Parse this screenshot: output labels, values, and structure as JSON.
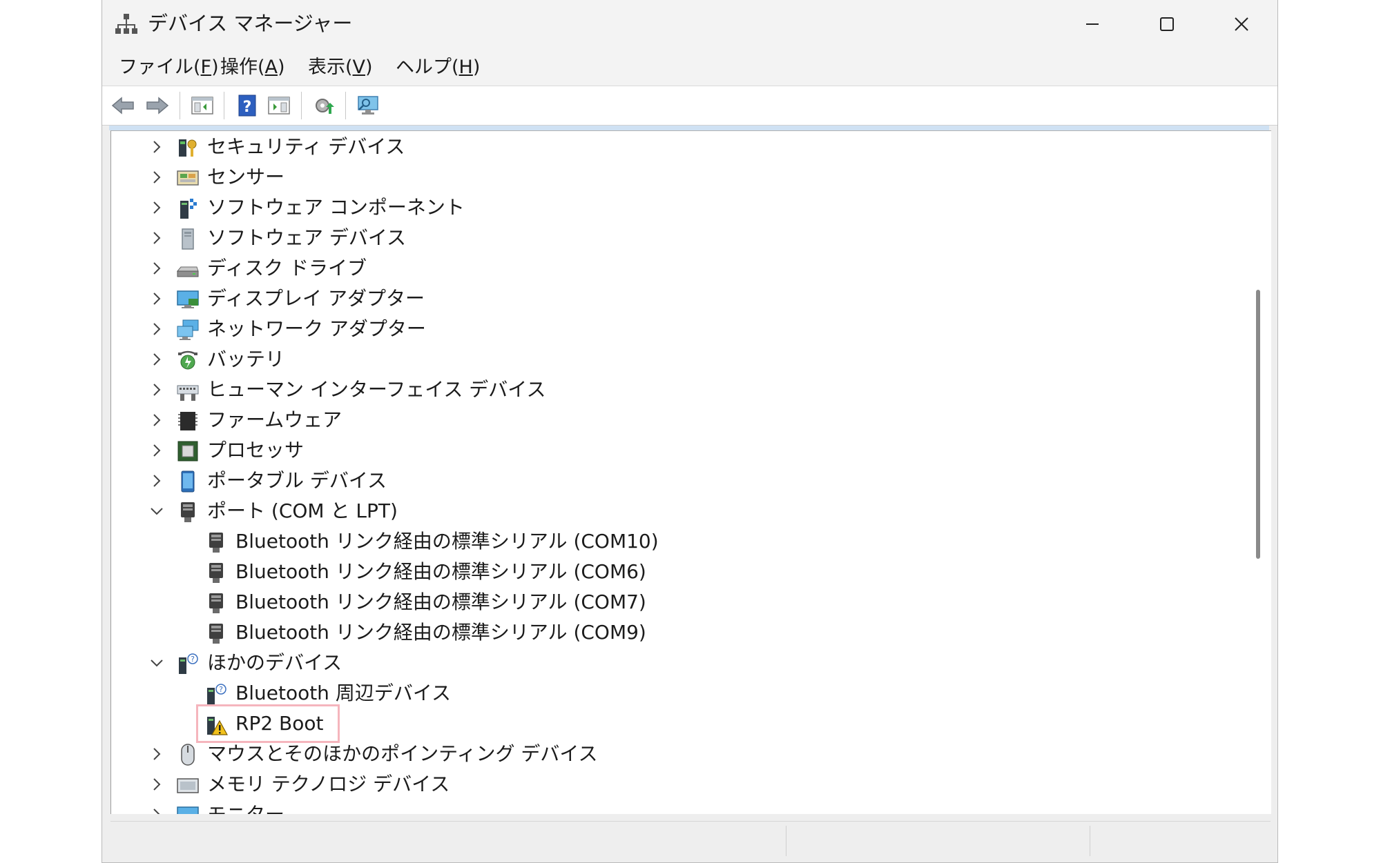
{
  "window": {
    "title": "デバイス マネージャー",
    "controls": {
      "minimize_icon": "minimize-icon",
      "maximize_icon": "maximize-icon",
      "close_icon": "close-icon"
    }
  },
  "menu": [
    {
      "label": "ファイル(",
      "accel": "F",
      "end": ")"
    },
    {
      "label": "操作(",
      "accel": "A",
      "end": ")"
    },
    {
      "label": "表示(",
      "accel": "V",
      "end": ")"
    },
    {
      "label": "ヘルプ(",
      "accel": "H",
      "end": ")"
    }
  ],
  "toolbar": {
    "buttons": [
      "back-icon",
      "forward-icon",
      "show-hide-console-tree-icon",
      "help-icon",
      "show-hide-action-pane-icon",
      "update-driver-icon",
      "scan-hardware-icon"
    ]
  },
  "tree": {
    "categories": [
      {
        "label": "セキュリティ デバイス",
        "icon": "security-device-icon",
        "expanded": false
      },
      {
        "label": "センサー",
        "icon": "sensor-icon",
        "expanded": false
      },
      {
        "label": "ソフトウェア コンポーネント",
        "icon": "software-component-icon",
        "expanded": false
      },
      {
        "label": "ソフトウェア デバイス",
        "icon": "software-device-icon",
        "expanded": false
      },
      {
        "label": "ディスク ドライブ",
        "icon": "disk-drive-icon",
        "expanded": false
      },
      {
        "label": "ディスプレイ アダプター",
        "icon": "display-adapter-icon",
        "expanded": false
      },
      {
        "label": "ネットワーク アダプター",
        "icon": "network-adapter-icon",
        "expanded": false
      },
      {
        "label": "バッテリ",
        "icon": "battery-icon",
        "expanded": false
      },
      {
        "label": "ヒューマン インターフェイス デバイス",
        "icon": "hid-icon",
        "expanded": false
      },
      {
        "label": "ファームウェア",
        "icon": "firmware-icon",
        "expanded": false
      },
      {
        "label": "プロセッサ",
        "icon": "processor-icon",
        "expanded": false
      },
      {
        "label": "ポータブル デバイス",
        "icon": "portable-device-icon",
        "expanded": false
      },
      {
        "label": "ポート (COM と LPT)",
        "icon": "port-icon",
        "expanded": true
      },
      {
        "label": "Bluetooth リンク経由の標準シリアル (COM10)",
        "icon": "port-icon",
        "child": true
      },
      {
        "label": "Bluetooth リンク経由の標準シリアル (COM6)",
        "icon": "port-icon",
        "child": true
      },
      {
        "label": "Bluetooth リンク経由の標準シリアル (COM7)",
        "icon": "port-icon",
        "child": true
      },
      {
        "label": "Bluetooth リンク経由の標準シリアル (COM9)",
        "icon": "port-icon",
        "child": true
      },
      {
        "label": "ほかのデバイス",
        "icon": "unknown-device-icon",
        "expanded": true
      },
      {
        "label": "Bluetooth 周辺デバイス",
        "icon": "unknown-device-icon",
        "child": true
      },
      {
        "label": "RP2 Boot",
        "icon": "warning-device-icon",
        "child": true,
        "highlighted": true
      },
      {
        "label": "マウスとそのほかのポインティング デバイス",
        "icon": "mouse-icon",
        "expanded": false
      },
      {
        "label": "メモリ テクノロジ デバイス",
        "icon": "memory-device-icon",
        "expanded": false
      },
      {
        "label": "モニター",
        "icon": "monitor-icon",
        "expanded": false
      }
    ]
  },
  "colors": {
    "highlight_border": "#f5b5bd",
    "scroll_thumb": "#8a8a8a"
  }
}
